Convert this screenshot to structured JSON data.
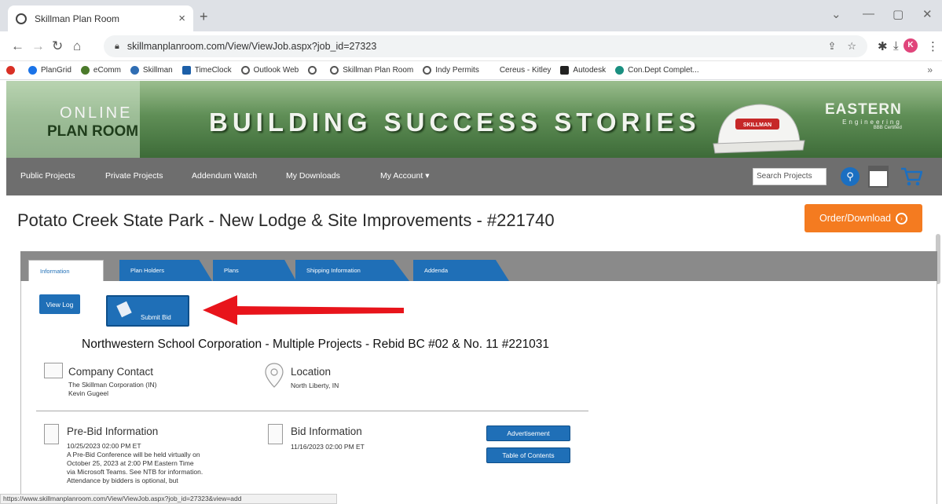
{
  "browser": {
    "tab_title": "Skillman Plan Room",
    "tab_close": "×",
    "new_tab": "+",
    "url": "skillmanplanroom.com/View/ViewJob.aspx?job_id=27323",
    "profile_initial": "K",
    "bookmarks": [
      {
        "label": "",
        "color": "#d93025"
      },
      {
        "label": "PlanGrid",
        "color": "#1a73e8"
      },
      {
        "label": "eComm",
        "color": "#4b7a2b"
      },
      {
        "label": "Skillman",
        "color": "#2f6db3"
      },
      {
        "label": "TimeClock",
        "color": "#1c5fa8"
      },
      {
        "label": "Outlook Web",
        "color": "#555555"
      },
      {
        "label": "",
        "color": "#555555"
      },
      {
        "label": "Skillman Plan Room",
        "color": "#555555"
      },
      {
        "label": "Indy Permits",
        "color": "#555555"
      },
      {
        "label": "Cereus - Kitley",
        "color": "#ffffff"
      },
      {
        "label": "Autodesk",
        "color": "#222222"
      },
      {
        "label": "Con.Dept Complet...",
        "color": "#1a8f80"
      }
    ],
    "status_url": "https://www.skillmanplanroom.com/View/ViewJob.aspx?job_id=27323&view=add"
  },
  "header": {
    "logo_top": "ONLINE",
    "logo_bottom": "PLAN ROOM",
    "headline": "BUILDING SUCCESS STORIES",
    "hardhat_text": "SKILLMAN",
    "eastern_name": "EASTERN",
    "eastern_sub": "Engineering",
    "eastern_tag": "BBB Certified"
  },
  "nav": {
    "items": [
      "Public Projects",
      "Private Projects",
      "Addendum Watch",
      "My Downloads",
      "My Account ▾"
    ],
    "search_placeholder": "Search Projects"
  },
  "page": {
    "title": "Potato Creek State Park - New Lodge & Site Improvements - #221740",
    "order_button": "Order/Download"
  },
  "tabs": [
    "Information",
    "Plan Holders",
    "Plans",
    "Shipping Information",
    "Addenda"
  ],
  "actions": {
    "view_log": "View Log",
    "submit_bid": "Submit Bid"
  },
  "caption": "Northwestern School Corporation - Multiple Projects - Rebid BC #02 & No. 11 #221031",
  "company_contact": {
    "title": "Company Contact",
    "line1": "The Skillman Corporation (IN)",
    "line2": "Kevin Gugeel"
  },
  "location": {
    "title": "Location",
    "value": "North Liberty, IN"
  },
  "prebid": {
    "title": "Pre-Bid Information",
    "date": "10/25/2023 02:00 PM ET",
    "lines": [
      "A Pre-Bid Conference will be held virtually on",
      "October 25, 2023 at 2:00 PM Eastern Time",
      "via Microsoft Teams. See NTB for information.",
      "Attendance by bidders is optional, but"
    ]
  },
  "bid_info": {
    "title": "Bid Information",
    "date": "11/16/2023 02:00 PM ET"
  },
  "doc_buttons": {
    "advertisement": "Advertisement",
    "toc": "Table of Contents"
  }
}
